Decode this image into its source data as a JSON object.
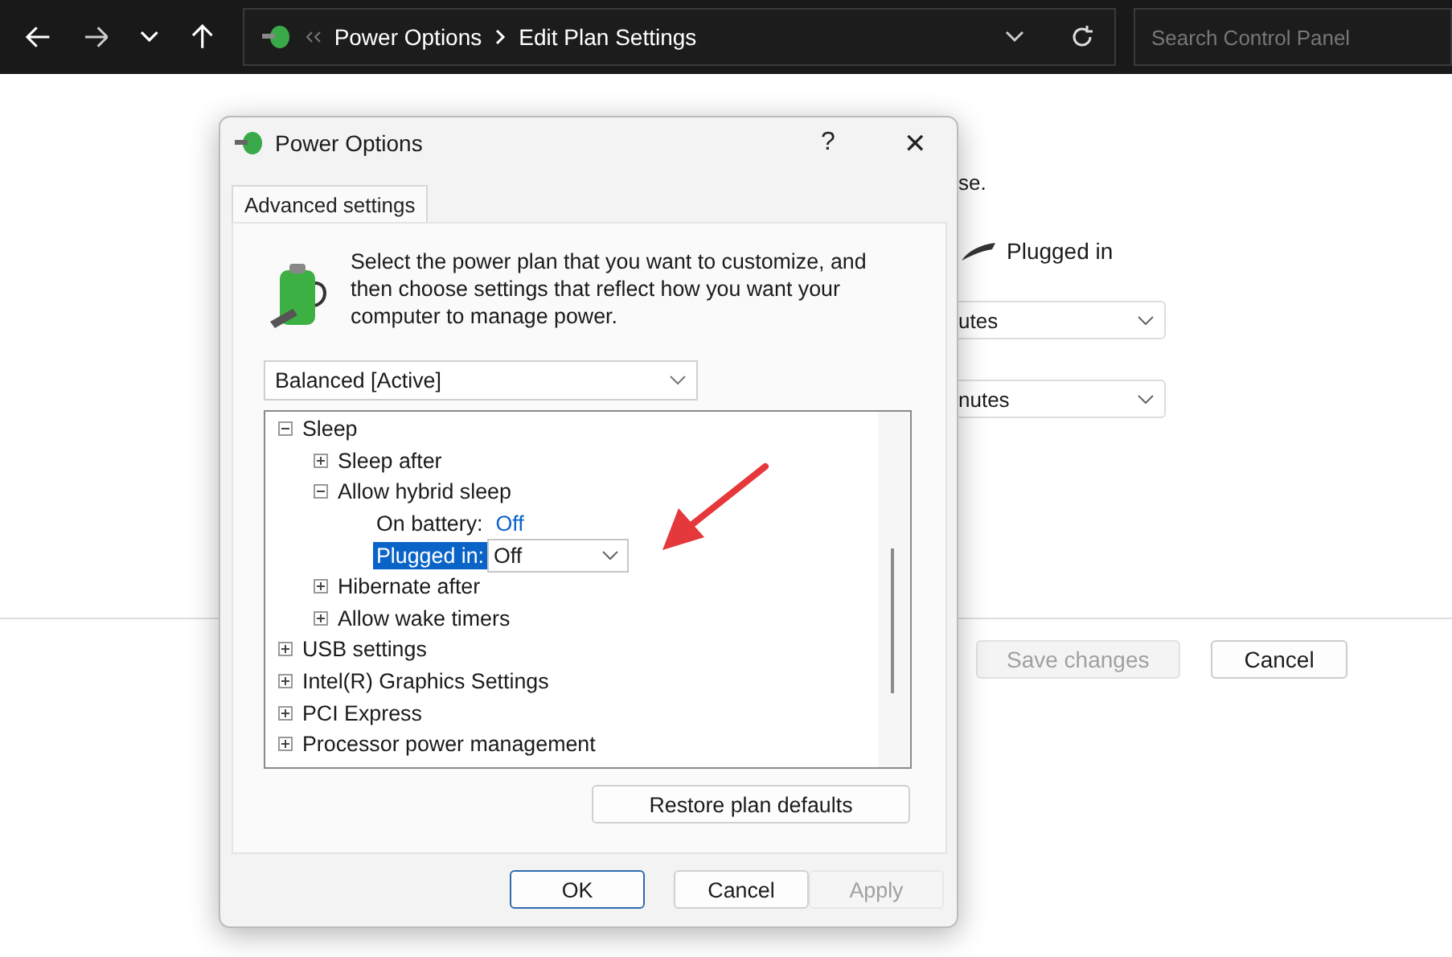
{
  "address_bar": {
    "breadcrumbs": [
      "Power Options",
      "Edit Plan Settings"
    ],
    "search": {
      "placeholder": "Search Control Panel"
    }
  },
  "background_page": {
    "text_fragment": "se.",
    "column_header": "Plugged in",
    "dropdowns": [
      "utes",
      "nutes"
    ],
    "buttons": [
      {
        "label": "Save changes",
        "disabled": true
      },
      {
        "label": "Cancel",
        "disabled": false
      }
    ]
  },
  "dialog": {
    "title": "Power Options",
    "help": "?",
    "close": "✕",
    "tabs": [
      {
        "label": "Advanced settings",
        "selected": true
      }
    ],
    "description": "Select the power plan that you want to customize, and then choose settings that reflect how you want your computer to manage power.",
    "plan": {
      "value": "Balanced [Active]"
    },
    "tree": [
      {
        "label": "Sleep",
        "expanded": true,
        "selected": false,
        "children": [
          {
            "label": "Sleep after",
            "expanded": false,
            "selected": false
          },
          {
            "label": "Allow hybrid sleep",
            "expanded": true,
            "selected": false,
            "children": [
              {
                "kind": "value",
                "label": "On battery:",
                "value": "Off",
                "selected": false
              },
              {
                "kind": "dropdown",
                "label": "Plugged in:",
                "value": "Off",
                "selected": true
              }
            ]
          },
          {
            "label": "Hibernate after",
            "expanded": false,
            "selected": false
          },
          {
            "label": "Allow wake timers",
            "expanded": false,
            "selected": false
          }
        ]
      },
      {
        "label": "USB settings",
        "expanded": false,
        "selected": false
      },
      {
        "label": "Intel(R) Graphics Settings",
        "expanded": false,
        "selected": false
      },
      {
        "label": "PCI Express",
        "expanded": false,
        "selected": false
      },
      {
        "label": "Processor power management",
        "expanded": false,
        "selected": false
      }
    ],
    "restore_button": "Restore plan defaults",
    "buttons": [
      {
        "label": "OK",
        "kind": "default",
        "disabled": false
      },
      {
        "label": "Cancel",
        "kind": "normal",
        "disabled": false
      },
      {
        "label": "Apply",
        "kind": "normal",
        "disabled": true
      }
    ]
  }
}
